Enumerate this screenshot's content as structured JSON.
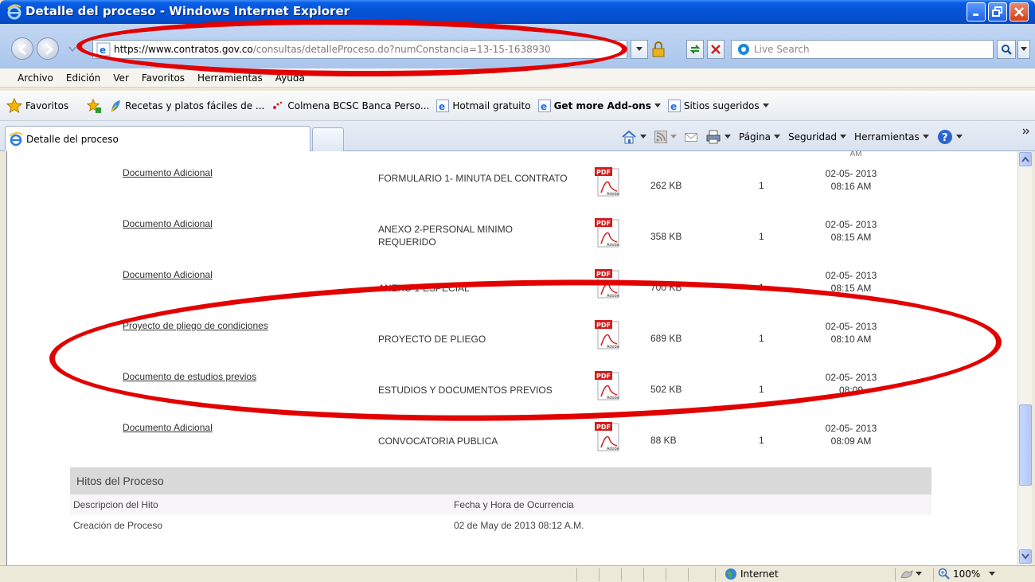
{
  "window": {
    "title": "Detalle del proceso - Windows Internet Explorer"
  },
  "address_bar": {
    "url_protocol": "https://",
    "url_domain": "www.contratos.gov.co",
    "url_path": "/consultas/detalleProceso.do?numConstancia=13-15-1638930",
    "search_placeholder": "Live Search"
  },
  "menu": {
    "items": [
      "Archivo",
      "Edición",
      "Ver",
      "Favoritos",
      "Herramientas",
      "Ayuda"
    ]
  },
  "favorites_bar": {
    "favorites_label": "Favoritos",
    "items": [
      {
        "label": "Recetas y platos fáciles de ..."
      },
      {
        "label": "Colmena BCSC  Banca Perso..."
      },
      {
        "label": "Hotmail gratuito"
      },
      {
        "label": "Get more Add-ons"
      },
      {
        "label": "Sitios sugeridos"
      }
    ]
  },
  "tabs": {
    "active_label": "Detalle del proceso"
  },
  "command_bar": {
    "page_label": "Página",
    "security_label": "Seguridad",
    "tools_label": "Herramientas"
  },
  "documents": [
    {
      "type": "Documento Adicional",
      "name": "FORMULARIO 1- MINUTA DEL CONTRATO",
      "size": "262 KB",
      "version": "1",
      "date": "02-05- 2013 08:16 AM"
    },
    {
      "type": "Documento Adicional",
      "name": "ANEXO 2-PERSONAL MINIMO REQUERIDO",
      "size": "358 KB",
      "version": "1",
      "date": "02-05- 2013 08:15 AM"
    },
    {
      "type": "Documento Adicional",
      "name": "ANEXO 1-ESPECIAL",
      "size": "700 KB",
      "version": "1",
      "date": "02-05- 2013 08:15 AM"
    },
    {
      "type": "Proyecto de pliego de condiciones",
      "name": "PROYECTO DE PLIEGO",
      "size": "689 KB",
      "version": "1",
      "date": "02-05- 2013 08:10 AM"
    },
    {
      "type": "Documento de estudios previos",
      "name": "ESTUDIOS Y DOCUMENTOS PREVIOS",
      "size": "502 KB",
      "version": "1",
      "date": "02-05- 2013 08:09"
    },
    {
      "type": "Documento Adicional",
      "name": "CONVOCATORIA PUBLICA",
      "size": "88 KB",
      "version": "1",
      "date": "02-05- 2013 08:09 AM"
    }
  ],
  "hitos": {
    "title": "Hitos del Proceso",
    "header": {
      "col1": "Descripcion del Hito",
      "col2": "Fecha y Hora de Ocurrencia"
    },
    "rows": [
      {
        "col1": "Creación de Proceso",
        "col2": "02 de May de 2013 08:12 A.M."
      }
    ]
  },
  "status_bar": {
    "zone": "Internet",
    "zoom": "100%"
  },
  "colors": {
    "annotation_red": "#e20000",
    "titlebar_blue": "#0553d6"
  }
}
